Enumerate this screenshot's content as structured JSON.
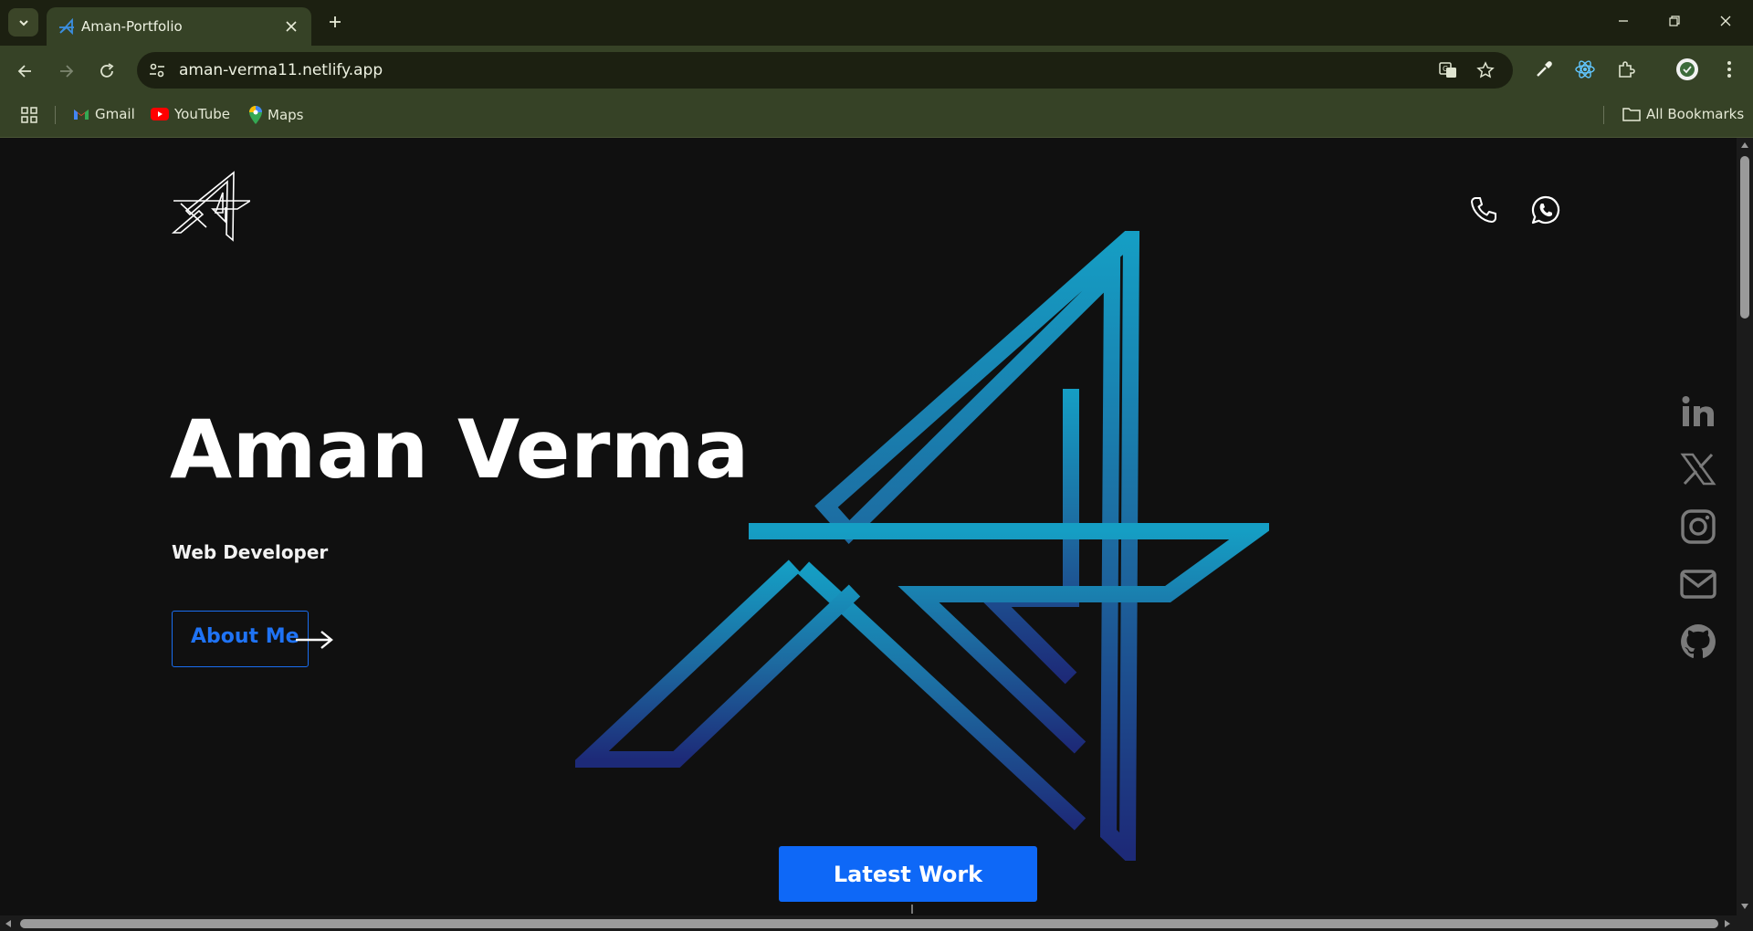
{
  "browser": {
    "tab_title": "Aman-Portfolio",
    "url": "aman-verma11.netlify.app",
    "bookmarks": [
      {
        "label": "Gmail",
        "icon": "gmail-icon"
      },
      {
        "label": "YouTube",
        "icon": "youtube-icon"
      },
      {
        "label": "Maps",
        "icon": "maps-icon"
      }
    ],
    "all_bookmarks_label": "All Bookmarks",
    "theme_colors": {
      "tabstrip": "#1c2011",
      "toolbar": "#364226"
    }
  },
  "page": {
    "hero": {
      "name": "Aman Verma",
      "role": "Web Developer",
      "about_button": "About Me"
    },
    "latest_work_button": "Latest Work",
    "header_icons": [
      "phone-icon",
      "whatsapp-icon"
    ],
    "social_icons": [
      "linkedin-icon",
      "x-twitter-icon",
      "instagram-icon",
      "mail-icon",
      "github-icon"
    ],
    "colors": {
      "background": "#101010",
      "accent_blue": "#0e68f7",
      "logo_gradient_top": "#159ec4",
      "logo_gradient_bottom": "#1d2a78",
      "social_icon": "#7a7a7a"
    }
  }
}
